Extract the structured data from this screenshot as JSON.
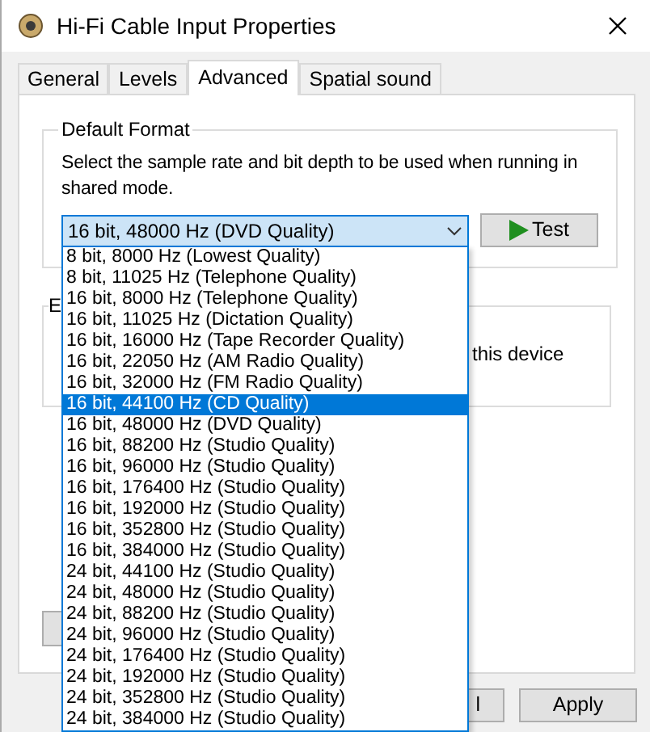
{
  "window": {
    "title": "Hi-Fi Cable Input Properties"
  },
  "tabs": [
    {
      "label": "General",
      "selected": false
    },
    {
      "label": "Levels",
      "selected": false
    },
    {
      "label": "Advanced",
      "selected": true
    },
    {
      "label": "Spatial sound",
      "selected": false
    }
  ],
  "default_format": {
    "label": "Default Format",
    "description": "Select the sample rate and bit depth to be used when running in shared mode.",
    "combo": {
      "value": "16 bit, 48000 Hz (DVD Quality)",
      "expanded": true
    },
    "test_button": "Test",
    "options": [
      {
        "label": "8 bit, 8000 Hz (Lowest Quality)",
        "selected": false
      },
      {
        "label": "8 bit, 11025 Hz (Telephone Quality)",
        "selected": false
      },
      {
        "label": "16 bit, 8000 Hz (Telephone Quality)",
        "selected": false
      },
      {
        "label": "16 bit, 11025 Hz (Dictation Quality)",
        "selected": false
      },
      {
        "label": "16 bit, 16000 Hz (Tape Recorder Quality)",
        "selected": false
      },
      {
        "label": "16 bit, 22050 Hz (AM Radio Quality)",
        "selected": false
      },
      {
        "label": "16 bit, 32000 Hz (FM Radio Quality)",
        "selected": false
      },
      {
        "label": "16 bit, 44100 Hz (CD Quality)",
        "selected": true
      },
      {
        "label": "16 bit, 48000 Hz (DVD Quality)",
        "selected": false
      },
      {
        "label": "16 bit, 88200 Hz (Studio Quality)",
        "selected": false
      },
      {
        "label": "16 bit, 96000 Hz (Studio Quality)",
        "selected": false
      },
      {
        "label": "16 bit, 176400 Hz (Studio Quality)",
        "selected": false
      },
      {
        "label": "16 bit, 192000 Hz (Studio Quality)",
        "selected": false
      },
      {
        "label": "16 bit, 352800 Hz (Studio Quality)",
        "selected": false
      },
      {
        "label": "16 bit, 384000 Hz (Studio Quality)",
        "selected": false
      },
      {
        "label": "24 bit, 44100 Hz (Studio Quality)",
        "selected": false
      },
      {
        "label": "24 bit, 48000 Hz (Studio Quality)",
        "selected": false
      },
      {
        "label": "24 bit, 88200 Hz (Studio Quality)",
        "selected": false
      },
      {
        "label": "24 bit, 96000 Hz (Studio Quality)",
        "selected": false
      },
      {
        "label": "24 bit, 176400 Hz (Studio Quality)",
        "selected": false
      },
      {
        "label": "24 bit, 192000 Hz (Studio Quality)",
        "selected": false
      },
      {
        "label": "24 bit, 352800 Hz (Studio Quality)",
        "selected": false
      },
      {
        "label": "24 bit, 384000 Hz (Studio Quality)",
        "selected": false
      }
    ]
  },
  "exclusive_group": {
    "label": "E",
    "text": "this device"
  },
  "buttons": [
    "l",
    "Apply"
  ]
}
